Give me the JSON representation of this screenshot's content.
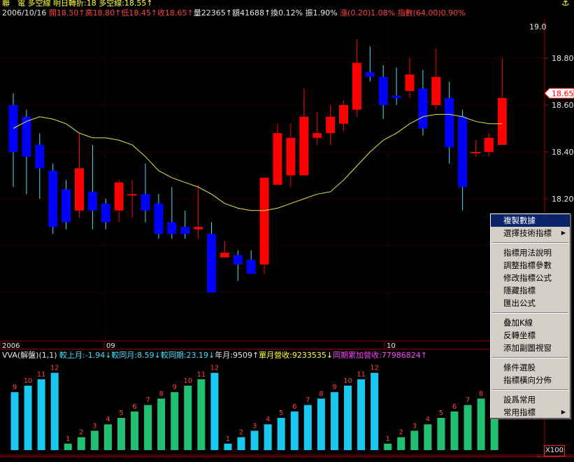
{
  "header": {
    "line1": [
      {
        "text": "聯　電",
        "color": "yellow"
      },
      {
        "text": " 多空線  明日轉折:18  多空線:18.55↑",
        "color": "yellow"
      }
    ],
    "line2": [
      {
        "text": "2006/10/16 ",
        "color": "white"
      },
      {
        "text": "開18.50↑高18.80↑低18.45↑收18.65↑",
        "color": "red"
      },
      {
        "text": "量22365↑額41688↑換0.12% 振1.90% ",
        "color": "white"
      },
      {
        "text": "漲(0.20)1.08% 指數(64.00)0.90%",
        "color": "red"
      }
    ]
  },
  "price_axis": {
    "top_label": "19.0",
    "labels": [
      "18.80",
      "18.60",
      "18.40",
      "18.20"
    ],
    "current_price": "18.65",
    "partial_labels": [
      "0",
      "0"
    ]
  },
  "time_axis": {
    "labels": [
      "2006",
      "09",
      "10"
    ]
  },
  "sub_header": [
    {
      "text": "VVA(解盤)(1,1) ",
      "color": "white"
    },
    {
      "text": "較上月:-1.94↓較同月:8.59↓較同期:23.19↓",
      "color": "cyan"
    },
    {
      "text": "年月:9509↑",
      "color": "white"
    },
    {
      "text": "單月營收:9233535↓",
      "color": "yellow"
    },
    {
      "text": "同期累加營收:77986824↑",
      "color": "magenta"
    }
  ],
  "chart_data": {
    "type": "candlestick",
    "ylim": [
      18.02,
      19.05
    ],
    "candles": [
      {
        "o": 18.6,
        "h": 18.65,
        "l": 18.25,
        "c": 18.4
      },
      {
        "o": 18.55,
        "h": 18.58,
        "l": 18.22,
        "c": 18.38
      },
      {
        "o": 18.43,
        "h": 18.48,
        "l": 18.2,
        "c": 18.33
      },
      {
        "o": 18.32,
        "h": 18.35,
        "l": 18.05,
        "c": 18.08
      },
      {
        "o": 18.24,
        "h": 18.28,
        "l": 18.07,
        "c": 18.1
      },
      {
        "o": 18.15,
        "h": 18.48,
        "l": 18.12,
        "c": 18.33
      },
      {
        "o": 18.23,
        "h": 18.43,
        "l": 18.07,
        "c": 18.15
      },
      {
        "o": 18.18,
        "h": 18.2,
        "l": 18.07,
        "c": 18.1
      },
      {
        "o": 18.15,
        "h": 18.28,
        "l": 18.1,
        "c": 18.27
      },
      {
        "o": 18.22,
        "h": 18.28,
        "l": 18.12,
        "c": 18.22
      },
      {
        "o": 18.22,
        "h": 18.35,
        "l": 18.1,
        "c": 18.15
      },
      {
        "o": 18.18,
        "h": 18.22,
        "l": 18.03,
        "c": 18.05
      },
      {
        "o": 18.1,
        "h": 18.25,
        "l": 18.03,
        "c": 18.05
      },
      {
        "o": 18.08,
        "h": 18.15,
        "l": 18.03,
        "c": 18.05
      },
      {
        "o": 18.07,
        "h": 18.26,
        "l": 18.03,
        "c": 18.08
      },
      {
        "o": 18.05,
        "h": 18.1,
        "l": 17.88,
        "c": 17.8
      },
      {
        "o": 17.95,
        "h": 18.02,
        "l": 17.95,
        "c": 17.97
      },
      {
        "o": 17.96,
        "h": 17.98,
        "l": 17.85,
        "c": 17.92
      },
      {
        "o": 17.94,
        "h": 17.98,
        "l": 17.9,
        "c": 17.88
      },
      {
        "o": 17.92,
        "h": 18.29,
        "l": 17.88,
        "c": 18.29
      },
      {
        "o": 18.26,
        "h": 18.52,
        "l": 18.26,
        "c": 18.48
      },
      {
        "o": 18.3,
        "h": 18.52,
        "l": 18.25,
        "c": 18.46
      },
      {
        "o": 18.3,
        "h": 18.67,
        "l": 18.3,
        "c": 18.55
      },
      {
        "o": 18.46,
        "h": 18.57,
        "l": 18.43,
        "c": 18.48
      },
      {
        "o": 18.48,
        "h": 18.6,
        "l": 18.43,
        "c": 18.55
      },
      {
        "o": 18.52,
        "h": 18.62,
        "l": 18.49,
        "c": 18.6
      },
      {
        "o": 18.58,
        "h": 18.88,
        "l": 18.55,
        "c": 18.78
      },
      {
        "o": 18.74,
        "h": 18.85,
        "l": 18.7,
        "c": 18.72
      },
      {
        "o": 18.72,
        "h": 18.77,
        "l": 18.54,
        "c": 18.6
      },
      {
        "o": 18.64,
        "h": 18.76,
        "l": 18.6,
        "c": 18.63
      },
      {
        "o": 18.66,
        "h": 18.8,
        "l": 18.63,
        "c": 18.73
      },
      {
        "o": 18.67,
        "h": 18.75,
        "l": 18.47,
        "c": 18.5
      },
      {
        "o": 18.6,
        "h": 18.84,
        "l": 18.58,
        "c": 18.72
      },
      {
        "o": 18.63,
        "h": 18.7,
        "l": 18.35,
        "c": 18.42
      },
      {
        "o": 18.55,
        "h": 18.58,
        "l": 18.15,
        "c": 18.25
      },
      {
        "o": 18.4,
        "h": 18.45,
        "l": 18.38,
        "c": 18.4
      },
      {
        "o": 18.4,
        "h": 18.48,
        "l": 18.38,
        "c": 18.46
      },
      {
        "o": 18.43,
        "h": 18.8,
        "l": 18.43,
        "c": 18.63
      }
    ],
    "ma_line": [
      18.5,
      18.53,
      18.55,
      18.54,
      18.52,
      18.48,
      18.46,
      18.46,
      18.45,
      18.43,
      18.38,
      18.32,
      18.29,
      18.27,
      18.25,
      18.22,
      18.18,
      18.16,
      18.15,
      18.15,
      18.16,
      18.18,
      18.2,
      18.22,
      18.23,
      18.28,
      18.34,
      18.4,
      18.45,
      18.48,
      18.52,
      18.55,
      18.56,
      18.56,
      18.55,
      18.53,
      18.52,
      18.52
    ],
    "vva_bars": [
      {
        "label": "9",
        "value": 9,
        "color": "cyan"
      },
      {
        "label": "10",
        "value": 10,
        "color": "cyan"
      },
      {
        "label": "11",
        "value": 11,
        "color": "cyan"
      },
      {
        "label": "12",
        "value": 12,
        "color": "cyan"
      },
      {
        "label": "1",
        "value": 1,
        "color": "green"
      },
      {
        "label": "2",
        "value": 2,
        "color": "green"
      },
      {
        "label": "3",
        "value": 3,
        "color": "green"
      },
      {
        "label": "4",
        "value": 4,
        "color": "green"
      },
      {
        "label": "5",
        "value": 5,
        "color": "green"
      },
      {
        "label": "6",
        "value": 6,
        "color": "green"
      },
      {
        "label": "7",
        "value": 7,
        "color": "green"
      },
      {
        "label": "8",
        "value": 8,
        "color": "green"
      },
      {
        "label": "9",
        "value": 9,
        "color": "green"
      },
      {
        "label": "10",
        "value": 10,
        "color": "green"
      },
      {
        "label": "11",
        "value": 11,
        "color": "green"
      },
      {
        "label": "12",
        "value": 12,
        "color": "cyan"
      },
      {
        "label": "1",
        "value": 1,
        "color": "cyan"
      },
      {
        "label": "2",
        "value": 2,
        "color": "cyan"
      },
      {
        "label": "3",
        "value": 3,
        "color": "cyan"
      },
      {
        "label": "4",
        "value": 4,
        "color": "cyan"
      },
      {
        "label": "5",
        "value": 5,
        "color": "cyan"
      },
      {
        "label": "6",
        "value": 6,
        "color": "cyan"
      },
      {
        "label": "7",
        "value": 7,
        "color": "cyan"
      },
      {
        "label": "8",
        "value": 8,
        "color": "cyan"
      },
      {
        "label": "9",
        "value": 9,
        "color": "cyan"
      },
      {
        "label": "10",
        "value": 10,
        "color": "cyan"
      },
      {
        "label": "11",
        "value": 11,
        "color": "cyan"
      },
      {
        "label": "12",
        "value": 12,
        "color": "cyan"
      },
      {
        "label": "1",
        "value": 1,
        "color": "green"
      },
      {
        "label": "2",
        "value": 2,
        "color": "green"
      },
      {
        "label": "3",
        "value": 3,
        "color": "green"
      },
      {
        "label": "4",
        "value": 4,
        "color": "green"
      },
      {
        "label": "5",
        "value": 5,
        "color": "green"
      },
      {
        "label": "6",
        "value": 6,
        "color": "green"
      },
      {
        "label": "7",
        "value": 7,
        "color": "green"
      },
      {
        "label": "8",
        "value": 8,
        "color": "green"
      },
      {
        "label": "9",
        "value": 9,
        "color": "green"
      }
    ]
  },
  "context_menu": {
    "groups": [
      [
        {
          "label": "複製數據",
          "highlighted": true,
          "submenu": false
        },
        {
          "label": "選擇技術指標",
          "highlighted": false,
          "submenu": true
        }
      ],
      [
        {
          "label": "指標用法說明",
          "highlighted": false,
          "submenu": false
        },
        {
          "label": "調整指標參數",
          "highlighted": false,
          "submenu": false
        },
        {
          "label": "修改指標公式",
          "highlighted": false,
          "submenu": false
        },
        {
          "label": "隱藏指標",
          "highlighted": false,
          "submenu": false
        },
        {
          "label": "匯出公式",
          "highlighted": false,
          "submenu": false
        }
      ],
      [
        {
          "label": "叠加K線",
          "highlighted": false,
          "submenu": false
        },
        {
          "label": "反轉坐標",
          "highlighted": false,
          "submenu": false
        },
        {
          "label": "添加副圖視窗",
          "highlighted": false,
          "submenu": false
        }
      ],
      [
        {
          "label": "條件選股",
          "highlighted": false,
          "submenu": false
        },
        {
          "label": "指標橫向分佈",
          "highlighted": false,
          "submenu": false
        }
      ],
      [
        {
          "label": "設爲常用",
          "highlighted": false,
          "submenu": false
        },
        {
          "label": "常用指標",
          "highlighted": false,
          "submenu": true
        }
      ]
    ]
  },
  "scale_badge": "X100",
  "colors": {
    "up": "#ff0000",
    "down": "#0000ff",
    "wick_up": "#ff0000",
    "wick_down": "#40e0ff",
    "ma": "#e6e640",
    "axis": "#a00000",
    "bar_cyan": "#18c8f0",
    "bar_green": "#20c070",
    "bar_label": "#ff4040"
  }
}
